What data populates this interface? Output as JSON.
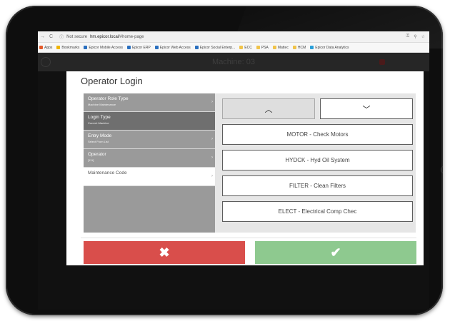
{
  "browser": {
    "security": "Not secure",
    "url_host": "hm.epicor.local",
    "url_path": "/#home-page",
    "bookmarks": [
      {
        "label": "Apps",
        "color": "#e35a2b"
      },
      {
        "label": "Bookmarks",
        "color": "#f0b400"
      },
      {
        "label": "Epicor Mobile Access",
        "color": "#2a6fbf"
      },
      {
        "label": "Epicor ERP",
        "color": "#2a6fbf"
      },
      {
        "label": "Epicor Web Access",
        "color": "#2a6fbf"
      },
      {
        "label": "Epicor Social Enterp...",
        "color": "#2a6fbf"
      },
      {
        "label": "ECC",
        "color": "#f0c34a"
      },
      {
        "label": "PSA",
        "color": "#f0c34a"
      },
      {
        "label": "Mattec",
        "color": "#f0c34a"
      },
      {
        "label": "HCM",
        "color": "#f0c34a"
      },
      {
        "label": "Epicor Data Analytics",
        "color": "#2a9fd8"
      }
    ]
  },
  "app": {
    "header_title": "Machine: 03"
  },
  "modal": {
    "title": "Operator Login",
    "fields": [
      {
        "label": "Operator Role Type",
        "value": "Machine Maintenance"
      },
      {
        "label": "Login Type",
        "value": "Current Machine"
      },
      {
        "label": "Entry Mode",
        "value": "Select From List"
      },
      {
        "label": "Operator",
        "value": "[111]"
      },
      {
        "label": "Maintenance Code",
        "value": ""
      }
    ],
    "options": [
      "MOTOR - Check Motors",
      "HYDCK - Hyd Oil System",
      "FILTER - Clean Filters",
      "ELECT - Electrical Comp Chec"
    ],
    "cancel_symbol": "✖",
    "confirm_symbol": "✔"
  },
  "colors": {
    "cancel": "#d94e4b",
    "confirm": "#8ec98f",
    "field_bg": "#9a9a9a"
  }
}
